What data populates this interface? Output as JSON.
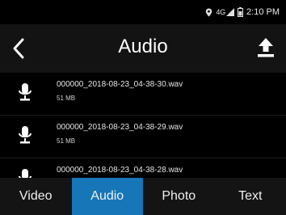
{
  "status_bar": {
    "network": "4G",
    "time": "2:10 PM",
    "icons": [
      "location-icon",
      "signal-icon",
      "battery-icon"
    ]
  },
  "header": {
    "title": "Audio",
    "back_icon": "back-chevron-icon",
    "upload_icon": "upload-icon"
  },
  "files": [
    {
      "name": "000000_2018-08-23_04-38-30.wav",
      "size": "51 MB",
      "icon": "microphone-icon"
    },
    {
      "name": "000000_2018-08-23_04-38-29.wav",
      "size": "51 MB",
      "icon": "microphone-icon"
    },
    {
      "name": "000000_2018-08-23_04-38-28.wav",
      "size": "",
      "icon": "microphone-icon"
    }
  ],
  "tabs": [
    {
      "label": "Video",
      "active": false
    },
    {
      "label": "Audio",
      "active": true
    },
    {
      "label": "Photo",
      "active": false
    },
    {
      "label": "Text",
      "active": false
    }
  ],
  "colors": {
    "background": "#000000",
    "header_bg": "#131313",
    "active_tab": "#1676b8",
    "text": "#ffffff"
  }
}
